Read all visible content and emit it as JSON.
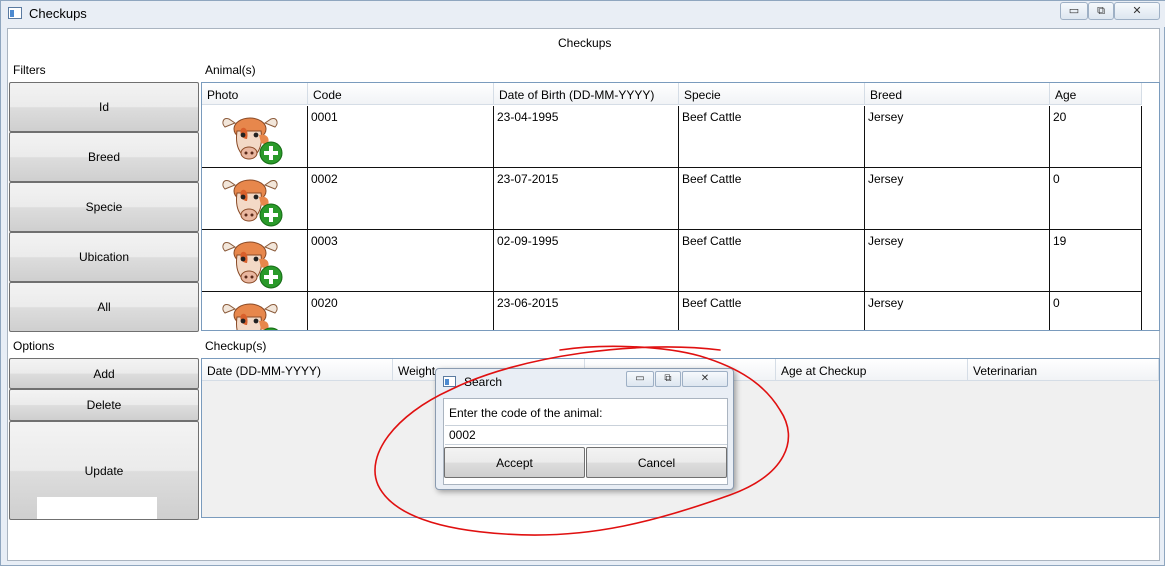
{
  "window": {
    "title": "Checkups",
    "minimize": "▭",
    "restore": "⧉",
    "close": "✕"
  },
  "main": {
    "heading": "Checkups",
    "filters_label": "Filters",
    "animals_label": "Animal(s)",
    "options_label": "Options",
    "checkups_label": "Checkup(s)"
  },
  "filters": {
    "buttons": [
      {
        "label": "Id"
      },
      {
        "label": "Breed"
      },
      {
        "label": "Specie"
      },
      {
        "label": "Ubication"
      },
      {
        "label": "All"
      }
    ]
  },
  "options": {
    "add": "Add",
    "delete": "Delete",
    "update": "Update"
  },
  "animals": {
    "columns": [
      "Photo",
      "Code",
      "Date of Birth (DD-MM-YYYY)",
      "Specie",
      "Breed",
      "Age"
    ],
    "rows": [
      {
        "photo": "cow-add-icon",
        "code": "0001",
        "dob": "23-04-1995",
        "specie": "Beef Cattle",
        "breed": "Jersey",
        "age": "20"
      },
      {
        "photo": "cow-add-icon",
        "code": "0002",
        "dob": "23-07-2015",
        "specie": "Beef Cattle",
        "breed": "Jersey",
        "age": "0"
      },
      {
        "photo": "cow-add-icon",
        "code": "0003",
        "dob": "02-09-1995",
        "specie": "Beef Cattle",
        "breed": "Jersey",
        "age": "19"
      },
      {
        "photo": "cow-add-icon",
        "code": "0020",
        "dob": "23-06-2015",
        "specie": "Beef Cattle",
        "breed": "Jersey",
        "age": "0"
      }
    ]
  },
  "checkups": {
    "columns": [
      "Date (DD-MM-YYYY)",
      "Weight",
      "",
      "Age at Checkup",
      "Veterinarian"
    ]
  },
  "dialog": {
    "title": "Search",
    "prompt": "Enter the code of the animal:",
    "input_value": "0002",
    "accept": "Accept",
    "cancel": "Cancel"
  },
  "colors": {
    "annotation": "#e01010",
    "border": "#7a9bbd"
  }
}
